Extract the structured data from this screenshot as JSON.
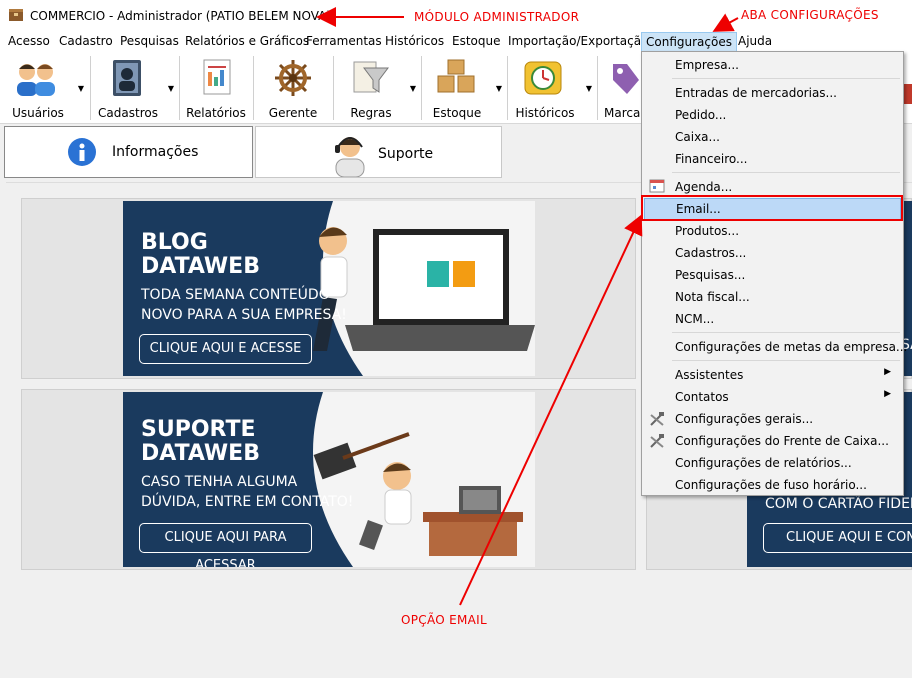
{
  "window": {
    "title": "COMMERCIO - Administrador (PATIO BELEM NOVA)"
  },
  "menubar": [
    "Acesso",
    "Cadastro",
    "Pesquisas",
    "Relatórios e Gráficos",
    "Ferramentas",
    "Históricos",
    "Estoque",
    "Importação/Exportação",
    "Configurações",
    "Ajuda"
  ],
  "toolbar": [
    "Usuários",
    "Cadastros",
    "Relatórios",
    "Gerente",
    "Regras",
    "Estoque",
    "Históricos",
    "Marca"
  ],
  "tabs": [
    "Informações",
    "Suporte"
  ],
  "banners": {
    "blog": {
      "head1": "BLOG",
      "head2": "DATAWEB",
      "sub1": "TODA SEMANA CONTEÚDO",
      "sub2": "NOVO PARA A SUA EMPRESA!",
      "button": "CLIQUE AQUI E ACESSE"
    },
    "suporte": {
      "head1": "SUPORTE",
      "head2": "DATAWEB",
      "sub1": "CASO TENHA ALGUMA",
      "sub2": "DÚVIDA, ENTRE EM CONTATO!",
      "button": "CLIQUE AQUI PARA ACESSAR"
    },
    "right": {
      "partial1": "SA",
      "partial2": "COM O CARTÃO FIDELIDADE",
      "button": "CLIQUE AQUI E CONHEÇA"
    }
  },
  "menu": {
    "items": [
      "Empresa...",
      "Entradas de mercadorias...",
      "Pedido...",
      "Caixa...",
      "Financeiro...",
      "Agenda...",
      "Email...",
      "Produtos...",
      "Cadastros...",
      "Pesquisas...",
      "Nota fiscal...",
      "NCM...",
      "Configurações de metas da empresa...",
      "Assistentes",
      "Contatos",
      "Configurações gerais...",
      "Configurações do Frente de Caixa...",
      "Configurações de relatórios...",
      "Configurações de fuso horário..."
    ]
  },
  "annotations": {
    "modulo": "MÓDULO ADMINISTRADOR",
    "aba": "ABA CONFIGURAÇÕES",
    "opcao": "OPÇÃO EMAIL"
  },
  "colors": {
    "accent_red": "#e00000",
    "banner_navy": "#1a3a5e",
    "highlight": "#bcd9f7"
  }
}
